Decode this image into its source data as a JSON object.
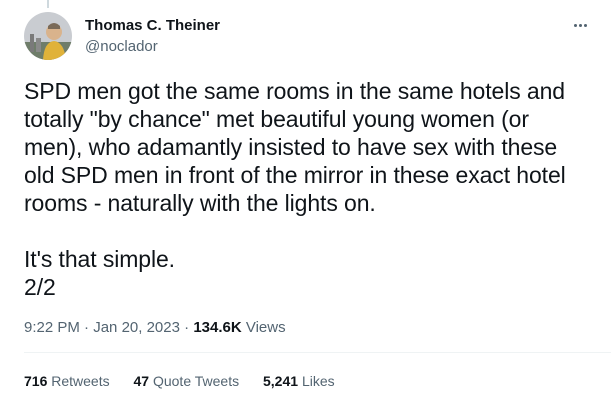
{
  "tweet": {
    "author": {
      "display_name": "Thomas C. Theiner",
      "handle": "@noclador"
    },
    "text": "SPD men got the same rooms in the same hotels and\ntotally \"by chance\" met beautiful young women (or\nmen), who adamantly insisted to have sex with these\nold SPD men in front of the mirror in these exact hotel\nrooms - naturally with the lights on.\n\nIt's that simple.\n2/2",
    "time": "9:22 PM",
    "date": "Jan 20, 2023",
    "separator": "·",
    "views_count": "134.6K",
    "views_label": "Views",
    "stats": {
      "retweets_count": "716",
      "retweets_label": "Retweets",
      "quotes_count": "47",
      "quotes_label": "Quote Tweets",
      "likes_count": "5,241",
      "likes_label": "Likes"
    }
  },
  "icons": {
    "more": "more-horizontal-icon"
  },
  "colors": {
    "text_primary": "#0f1419",
    "text_secondary": "#536471",
    "divider": "#eff3f4"
  }
}
